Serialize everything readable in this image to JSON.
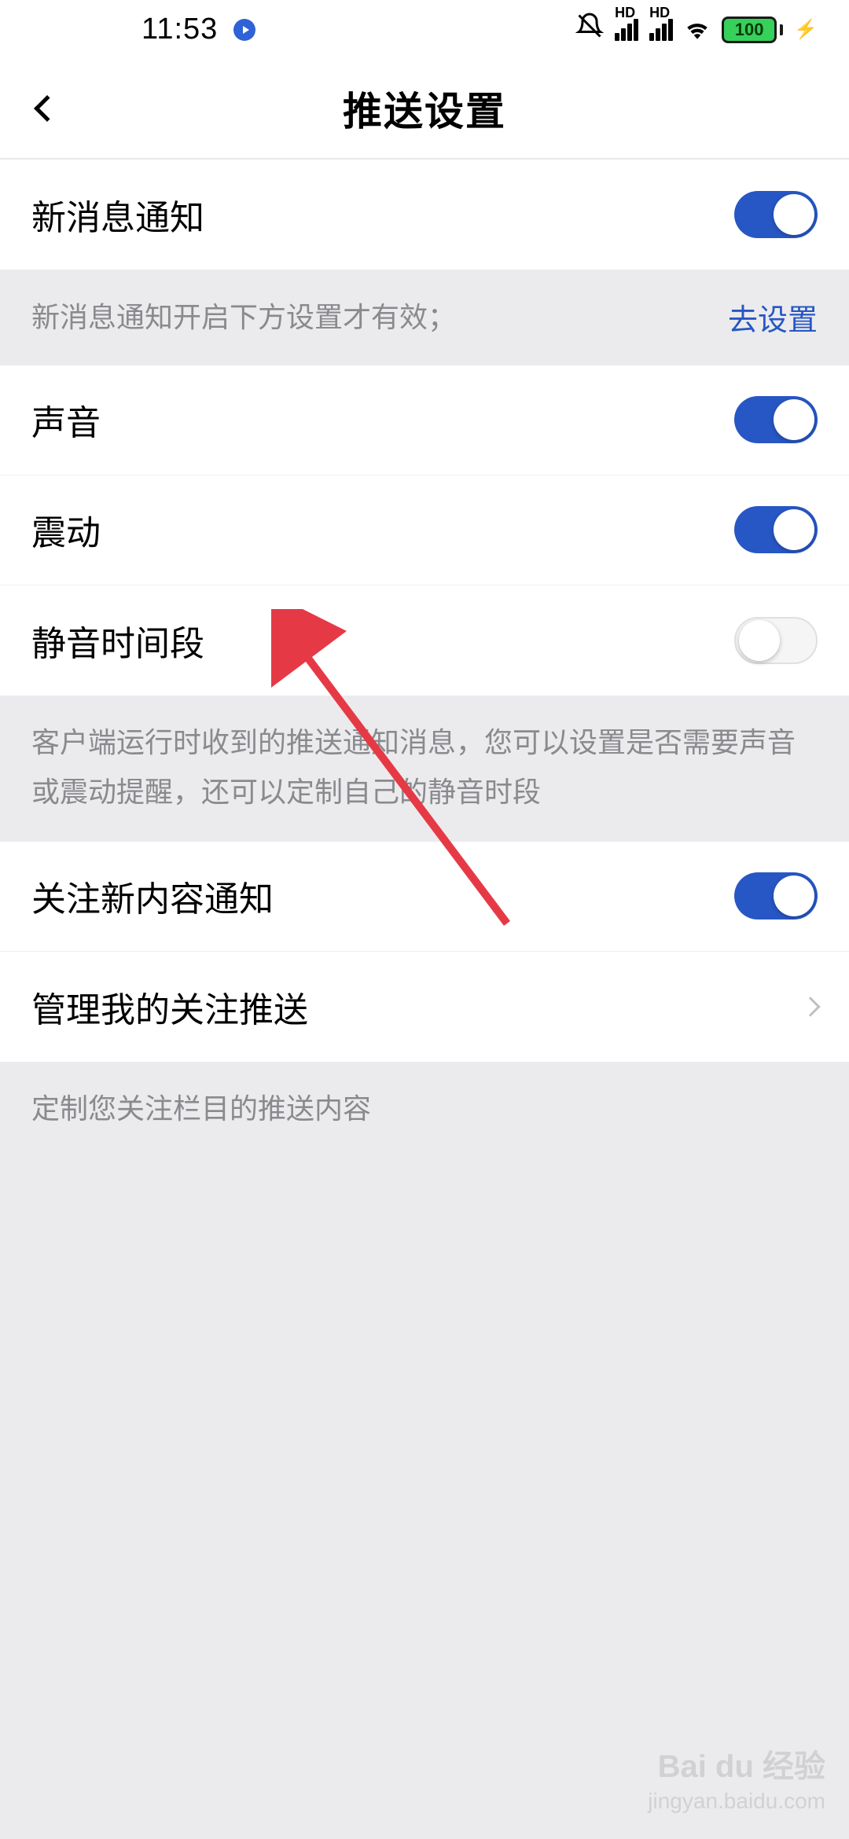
{
  "status": {
    "time": "11:53",
    "battery": "100",
    "signal_label": "HD"
  },
  "header": {
    "title": "推送设置"
  },
  "section1": {
    "new_message": {
      "label": "新消息通知",
      "on": true
    },
    "info_text": "新消息通知开启下方设置才有效；",
    "info_link": "去设置"
  },
  "section2": {
    "sound": {
      "label": "声音",
      "on": true
    },
    "vibrate": {
      "label": "震动",
      "on": true
    },
    "quiet": {
      "label": "静音时间段",
      "on": false
    },
    "info_text": "客户端运行时收到的推送通知消息，您可以设置是否需要声音或震动提醒，还可以定制自己的静音时段"
  },
  "section3": {
    "follow_new": {
      "label": "关注新内容通知",
      "on": true
    },
    "manage": {
      "label": "管理我的关注推送"
    },
    "info_text": "定制您关注栏目的推送内容"
  },
  "watermark": {
    "brand": "Bai du 经验",
    "url": "jingyan.baidu.com"
  },
  "colors": {
    "toggle_on": "#2757c4",
    "link": "#2757c4",
    "battery_fill": "#35d15b",
    "arrow": "#e63946"
  }
}
